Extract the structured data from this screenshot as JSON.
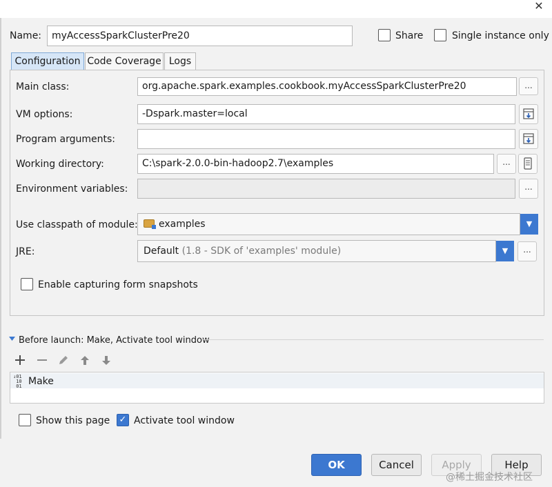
{
  "window": {
    "close_glyph": "✕"
  },
  "name": {
    "label": "Name:",
    "value": "myAccessSparkClusterPre20"
  },
  "share": {
    "label": "Share",
    "checked": false
  },
  "single_instance": {
    "label": "Single instance only",
    "checked": false
  },
  "tabs": [
    {
      "label": "Configuration",
      "active": true
    },
    {
      "label": "Code Coverage",
      "active": false
    },
    {
      "label": "Logs",
      "active": false
    }
  ],
  "config": {
    "main_class": {
      "label": "Main class:",
      "value": "org.apache.spark.examples.cookbook.myAccessSparkClusterPre20",
      "button": "..."
    },
    "vm_options": {
      "label": "VM options:",
      "value": "-Dspark.master=local"
    },
    "program_arguments": {
      "label": "Program arguments:",
      "value": ""
    },
    "working_directory": {
      "label": "Working directory:",
      "value": "C:\\spark-2.0.0-bin-hadoop2.7\\examples",
      "button": "..."
    },
    "environment_variables": {
      "label": "Environment variables:",
      "value": "",
      "button": "..."
    },
    "classpath_module": {
      "label": "Use classpath of module:",
      "value": "examples"
    },
    "jre": {
      "label": "JRE:",
      "value": "Default",
      "detail": "(1.8 - SDK of 'examples' module)",
      "button": "..."
    },
    "snapshots": {
      "label": "Enable capturing form snapshots",
      "checked": false
    }
  },
  "before_launch": {
    "label": "Before launch: Make, Activate tool window",
    "toolbar": [
      "add-icon",
      "remove-icon",
      "edit-icon",
      "move-up-icon",
      "move-down-icon"
    ],
    "items": [
      "Make"
    ]
  },
  "show_page": {
    "label": "Show this page",
    "checked": false
  },
  "activate_tool_window": {
    "label": "Activate tool window",
    "checked": true
  },
  "buttons": {
    "ok": "OK",
    "cancel": "Cancel",
    "apply": "Apply",
    "help": "Help"
  },
  "watermark": "@稀土掘金技术社区",
  "colors": {
    "accent": "#3c78d0",
    "tab_active": "#d6e6f7",
    "background": "#f2f2f2"
  }
}
